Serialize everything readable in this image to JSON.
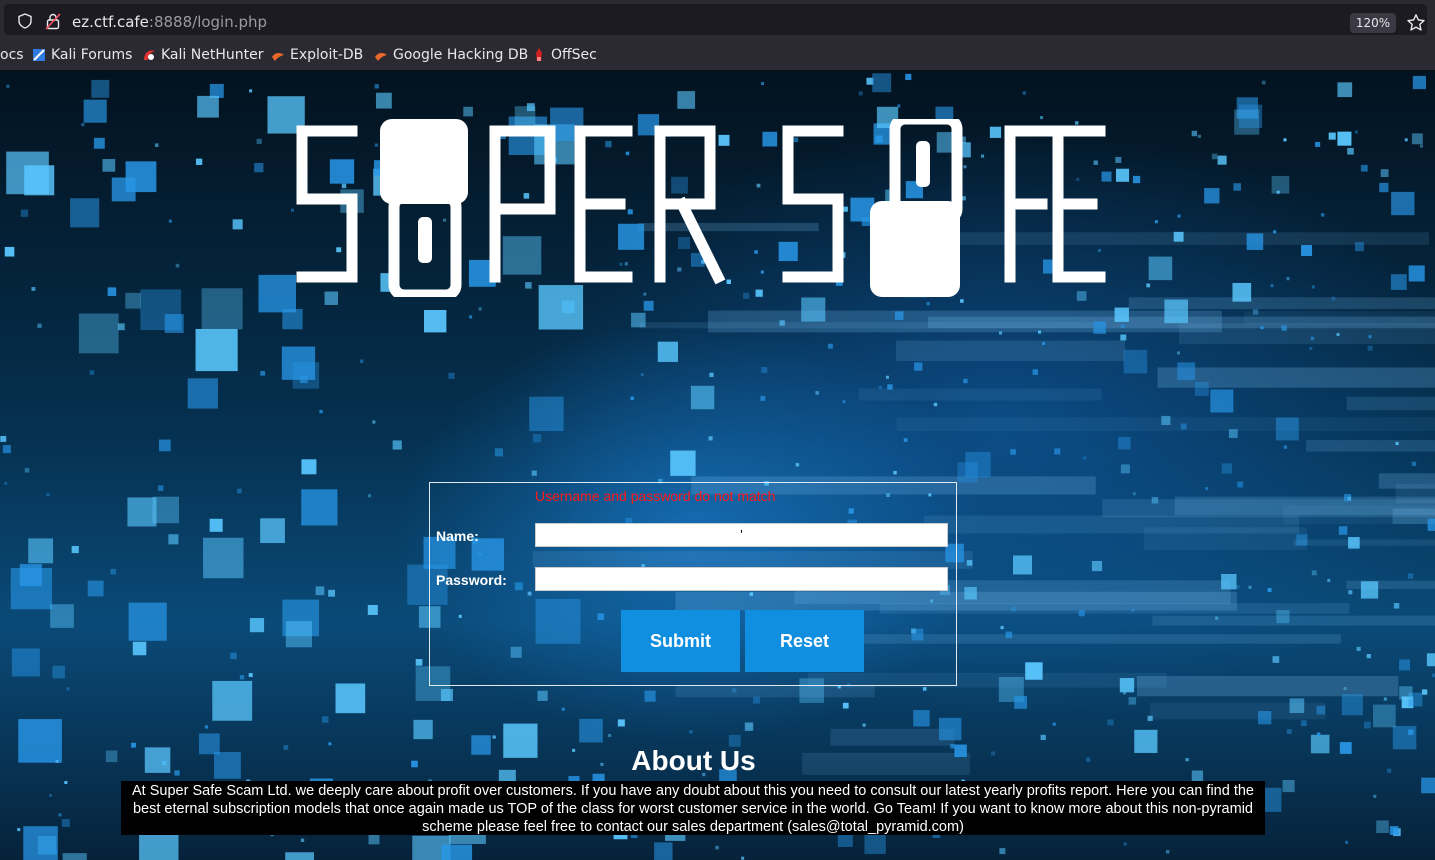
{
  "browser": {
    "url_host": "ez.ctf.cafe",
    "url_rest": ":8888/login.php",
    "zoom": "120%",
    "bookmarks": [
      {
        "label": "ocs",
        "icon": "none"
      },
      {
        "label": "Kali Forums",
        "icon": "kali-forums-icon"
      },
      {
        "label": "Kali NetHunter",
        "icon": "kali-nethunter-icon"
      },
      {
        "label": "Exploit-DB",
        "icon": "exploit-db-icon"
      },
      {
        "label": "Google Hacking DB",
        "icon": "ghdb-icon"
      },
      {
        "label": "OffSec",
        "icon": "offsec-icon"
      }
    ]
  },
  "logo": {
    "text": "SUPER SAFE"
  },
  "login": {
    "error": "Username and password do not match",
    "name_label": "Name:",
    "name_value": "'",
    "password_label": "Password:",
    "password_value": "",
    "submit_label": "Submit",
    "reset_label": "Reset"
  },
  "about": {
    "heading": "About Us",
    "text": "At Super Safe Scam Ltd. we deeply care about profit over customers. If you have any doubt about this you need to consult our latest yearly profits report. Here you can find the best eternal subscription models that once again made us TOP of the class for worst customer service in the world. Go Team! If you want to know more about this non-pyramid scheme please feel free to contact our sales department (sales@total_pyramid.com)"
  },
  "colors": {
    "accent": "#108ee0",
    "error": "#ff1a1a",
    "chrome": "#2b2a33"
  }
}
